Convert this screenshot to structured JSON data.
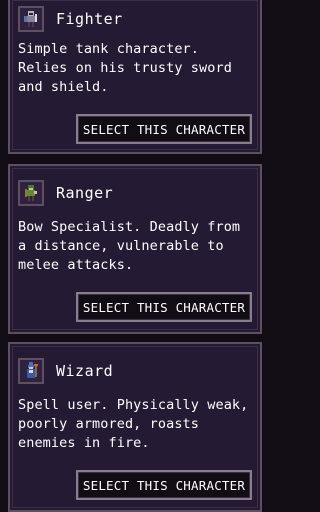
{
  "characters": [
    {
      "name": "Fighter",
      "description": "Simple tank character. Relies on his trusty sword and shield.",
      "button_label": "SELECT THIS CHARACTER",
      "icon": "fighter-portrait-icon"
    },
    {
      "name": "Ranger",
      "description": "Bow Specialist. Deadly from a distance, vulnerable to melee attacks.",
      "button_label": "SELECT THIS CHARACTER",
      "icon": "ranger-portrait-icon"
    },
    {
      "name": "Wizard",
      "description": "Spell user. Physically weak, poorly armored, roasts enemies in fire.",
      "button_label": "SELECT THIS CHARACTER",
      "icon": "wizard-portrait-icon"
    }
  ],
  "colors": {
    "background": "#120c14",
    "card": "#241a33",
    "card_border": "#5e5061",
    "button_border": "#8a7d8c",
    "text": "#ffffff"
  }
}
